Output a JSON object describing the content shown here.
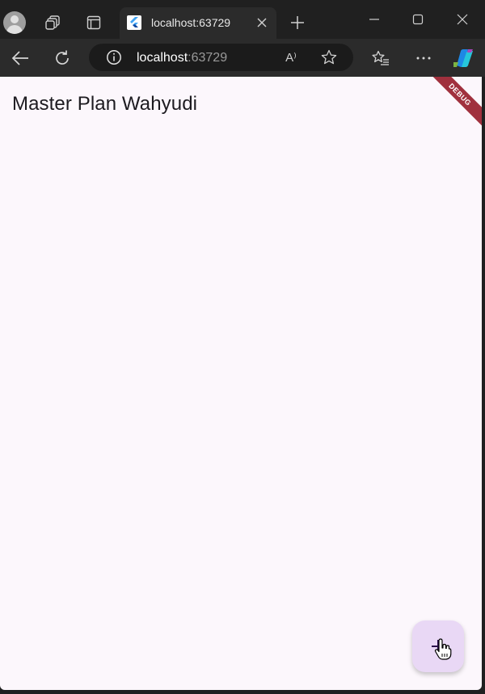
{
  "browser": {
    "tab": {
      "title": "localhost:63729",
      "favicon": "flutter-icon"
    },
    "address": {
      "host": "localhost",
      "port": ":63729"
    },
    "icons": {
      "profile": "profile-icon",
      "workspaces": "workspaces-icon",
      "tab_actions": "tab-actions-icon",
      "new_tab": "plus-icon",
      "back": "back-arrow-icon",
      "refresh": "refresh-icon",
      "site_info": "info-icon",
      "read_aloud": "read-aloud-icon",
      "favorite": "star-icon",
      "favorites_hub": "favorites-icon",
      "more": "more-icon",
      "copilot": "copilot-icon",
      "minimize": "minimize-icon",
      "maximize": "maximize-icon",
      "close": "close-icon"
    },
    "read_aloud_label": "A⁾"
  },
  "app": {
    "title": "Master Plan Wahyudi",
    "debug_banner": "DEBUG",
    "fab_icon": "add-icon"
  },
  "colors": {
    "page_background": "#fcf7fc",
    "fab_background": "#e9d8f5",
    "debug_banner": "#a0303d",
    "title_text": "#1d1b20"
  }
}
